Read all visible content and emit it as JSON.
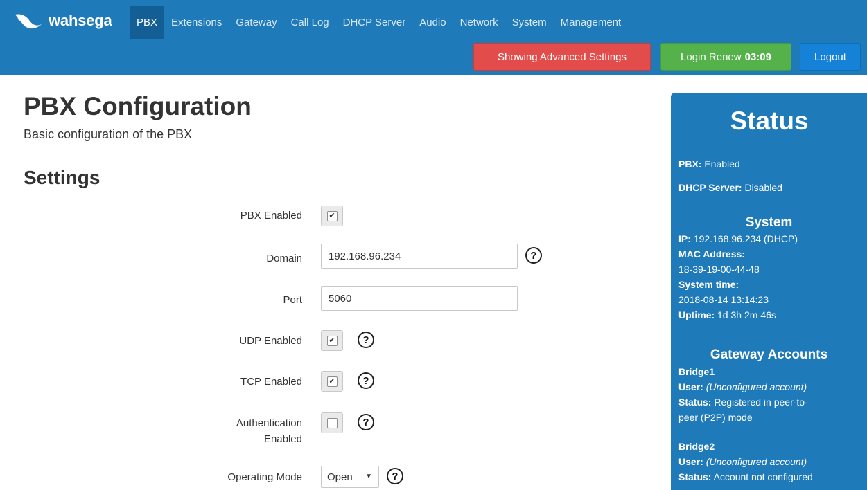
{
  "brand": {
    "name": "wahsega"
  },
  "nav": {
    "items": [
      "PBX",
      "Extensions",
      "Gateway",
      "Call Log",
      "DHCP Server",
      "Audio",
      "Network",
      "System",
      "Management"
    ]
  },
  "toolbar": {
    "advanced_label": "Showing Advanced Settings",
    "login_renew_label": "Login Renew",
    "login_renew_timer": "03:09",
    "logout_label": "Logout"
  },
  "page": {
    "title": "PBX Configuration",
    "subtitle": "Basic configuration of the PBX",
    "section_title": "Settings"
  },
  "form": {
    "pbx_enabled": {
      "label": "PBX Enabled",
      "checked": true,
      "mark": "✔"
    },
    "domain": {
      "label": "Domain",
      "value": "192.168.96.234"
    },
    "port": {
      "label": "Port",
      "value": "5060"
    },
    "udp_enabled": {
      "label": "UDP Enabled",
      "checked": true,
      "mark": "✔"
    },
    "tcp_enabled": {
      "label": "TCP Enabled",
      "checked": true,
      "mark": "✔"
    },
    "auth_enabled": {
      "label_line1": "Authentication",
      "label_line2": "Enabled",
      "checked": false,
      "mark": ""
    },
    "operating_mode": {
      "label": "Operating Mode",
      "value": "Open",
      "caret": "▼"
    },
    "help_glyph": "?"
  },
  "status": {
    "title": "Status",
    "pbx": {
      "key": "PBX:",
      "value": "Enabled"
    },
    "dhcp": {
      "key": "DHCP Server:",
      "value": "Disabled"
    },
    "system": {
      "heading": "System",
      "ip_key": "IP:",
      "ip_value": "192.168.96.234 (DHCP)",
      "mac_key": "MAC Address:",
      "mac_value": "18-39-19-00-44-48",
      "time_key": "System time:",
      "time_value": "2018-08-14 13:14:23",
      "uptime_key": "Uptime:",
      "uptime_value": "1d 3h 2m 46s"
    },
    "gateway": {
      "heading": "Gateway Accounts",
      "accounts": [
        {
          "name": "Bridge1",
          "user_key": "User:",
          "user_value": "(Unconfigured account)",
          "status_key": "Status:",
          "status_line1": "Registered in peer-to-",
          "status_line2": "peer (P2P) mode"
        },
        {
          "name": "Bridge2",
          "user_key": "User:",
          "user_value": "(Unconfigured account)",
          "status_key": "Status:",
          "status_line1": "Account not configured"
        }
      ]
    }
  },
  "colors": {
    "nav_bg": "#1f7ab9",
    "nav_active": "#135f95",
    "danger": "#e24d4b",
    "success": "#55b24b",
    "primary": "#1582d8"
  },
  "icons": {
    "logo": "wahsega-wave-logo",
    "help": "question-circle-icon",
    "checkbox_check": "checkmark-icon",
    "select_caret": "caret-down-icon"
  }
}
